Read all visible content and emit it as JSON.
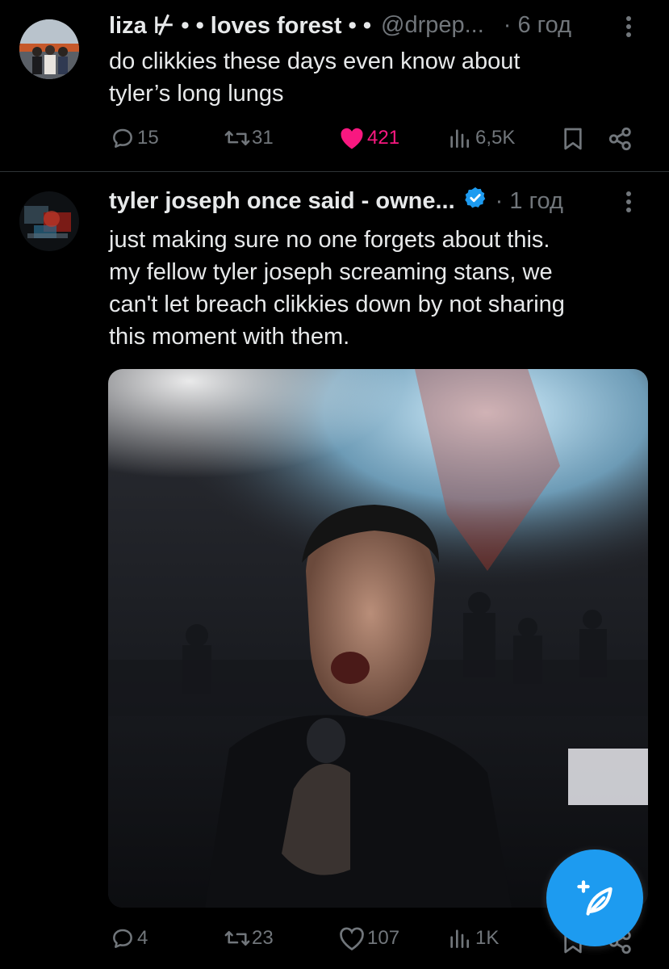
{
  "tweets": [
    {
      "author_name": "liza ⊬ • • loves forest • •",
      "handle": "@drpep...",
      "time": "· 6 год",
      "text_lines": [
        "do clikkies these days even know about",
        "tyler’s long lungs"
      ],
      "replies": "15",
      "retweets": "31",
      "likes": "421",
      "liked": true,
      "views": "6,5K"
    },
    {
      "author_name": "tyler joseph once said - owne...",
      "verified": true,
      "time": "· 1 год",
      "text_lines": [
        "just making sure no one forgets about this.",
        "my fellow tyler joseph screaming stans, we",
        "can't let breach clikkies down by not sharing",
        "this moment with them."
      ],
      "replies": "4",
      "retweets": "23",
      "likes": "107",
      "liked": false,
      "views": "1K"
    }
  ],
  "colors": {
    "accent": "#1d9bf0",
    "like": "#f91880",
    "muted": "#71767b",
    "text": "#e7e9ea"
  },
  "icons": [
    "reply-icon",
    "retweet-icon",
    "like-icon",
    "views-icon",
    "bookmark-icon",
    "share-icon",
    "compose-icon",
    "verified-icon",
    "more-icon"
  ]
}
